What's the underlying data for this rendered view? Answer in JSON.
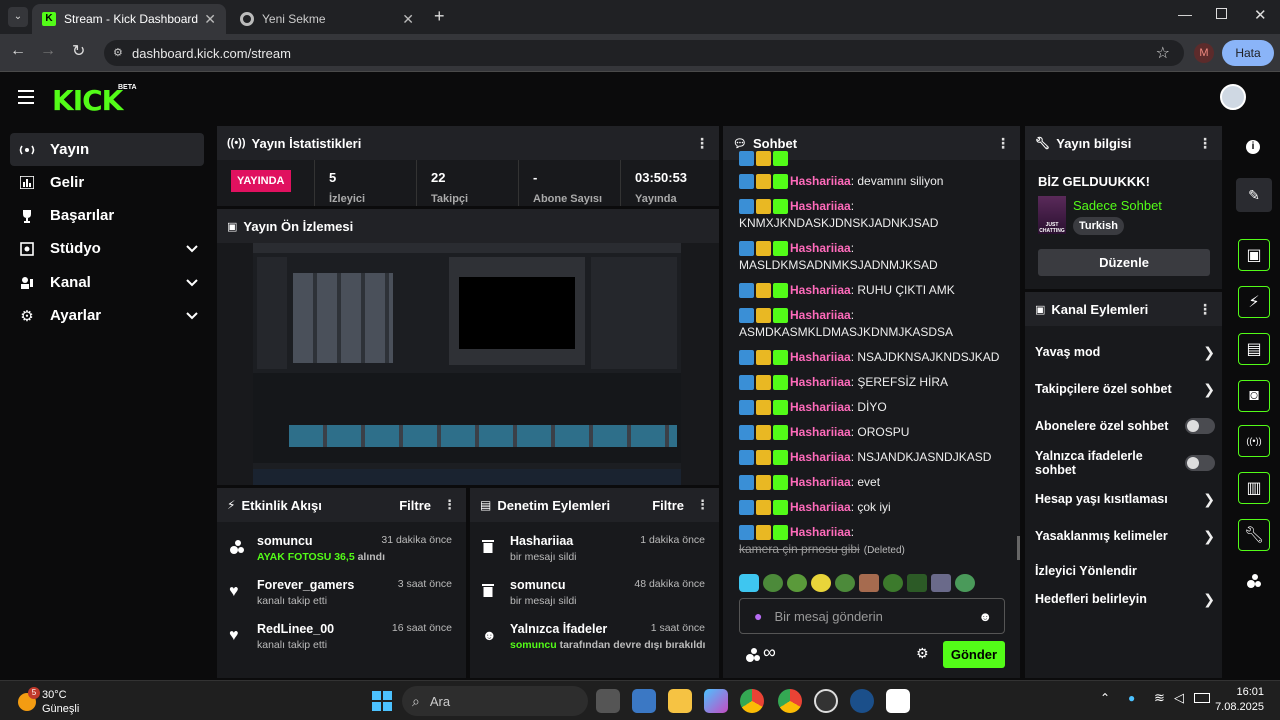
{
  "browser": {
    "tabs": [
      {
        "title": "Stream - Kick Dashboard"
      },
      {
        "title": "Yeni Sekme"
      }
    ],
    "url": "dashboard.kick.com/stream",
    "profile_initial": "M",
    "error_button": "Hata"
  },
  "header": {
    "logo": "KICK",
    "beta": "BETA"
  },
  "sidebar": {
    "items": [
      {
        "label": "Yayın",
        "icon": "broadcast-icon"
      },
      {
        "label": "Gelir",
        "icon": "chart-icon"
      },
      {
        "label": "Başarılar",
        "icon": "trophy-icon"
      },
      {
        "label": "Stüdyo",
        "icon": "studio-icon"
      },
      {
        "label": "Kanal",
        "icon": "channel-icon"
      },
      {
        "label": "Ayarlar",
        "icon": "gear-icon"
      }
    ]
  },
  "stats": {
    "title": "Yayın İstatistikleri",
    "live_badge": "YAYINDA",
    "cells": [
      {
        "value": "5",
        "label": "İzleyici"
      },
      {
        "value": "22",
        "label": "Takipçi"
      },
      {
        "value": "-",
        "label": "Abone Sayısı"
      },
      {
        "value": "03:50:53",
        "label": "Yayında"
      }
    ]
  },
  "preview": {
    "title": "Yayın Ön İzlemesi"
  },
  "activity": {
    "title": "Etkinlik Akışı",
    "filter": "Filtre",
    "items": [
      {
        "user": "somuncu",
        "time": "31 dakika önce",
        "highlight": "AYAK FOTOSU 36,5",
        "rest": " alındı"
      },
      {
        "user": "Forever_gamers",
        "time": "3 saat önce",
        "sub": "kanalı takip etti"
      },
      {
        "user": "RedLinee_00",
        "time": "16 saat önce",
        "sub": "kanalı takip etti"
      }
    ]
  },
  "moderation": {
    "title": "Denetim Eylemleri",
    "filter": "Filtre",
    "items": [
      {
        "user": "Hashariiaa",
        "time": "1 dakika önce",
        "sub": "bir mesajı sildi"
      },
      {
        "user": "somuncu",
        "time": "48 dakika önce",
        "sub": "bir mesajı sildi"
      },
      {
        "user": "Yalnızca İfadeler",
        "time": "1 saat önce",
        "sub_user": "somuncu",
        "sub": " tarafından devre dışı bırakıldı"
      }
    ]
  },
  "chat": {
    "title": "Sohbet",
    "messages": [
      {
        "user": "Hashariiaa",
        "text": "devamını siliyon"
      },
      {
        "user": "Hashariiaa",
        "text": "KNMXJKNDASKJDNSKJADNKJSAD"
      },
      {
        "user": "Hashariiaa",
        "text": "MASLDKMSADNMKSJADNMJKSAD"
      },
      {
        "user": "Hashariiaa",
        "text": "RUHU ÇIKTI AMK"
      },
      {
        "user": "Hashariiaa",
        "text": "ASMDKASMKLDMASJKDNMJKASDSA"
      },
      {
        "user": "Hashariiaa",
        "text": "NSAJDKNSAJKNDSJKAD"
      },
      {
        "user": "Hashariiaa",
        "text": "ŞEREFSİZ HİRA"
      },
      {
        "user": "Hashariiaa",
        "text": "DİYO"
      },
      {
        "user": "Hashariiaa",
        "text": "OROSPU"
      },
      {
        "user": "Hashariiaa",
        "text": "NSJANDKJASNDJKASD"
      },
      {
        "user": "Hashariiaa",
        "text": "evet"
      },
      {
        "user": "Hashariiaa",
        "text": "çok iyi"
      },
      {
        "user": "Hashariiaa",
        "text": "kamera çin prnosu gibi",
        "deleted": "(Deleted)"
      }
    ],
    "input_placeholder": "Bir mesaj gönderin",
    "send_button": "Gönder",
    "infinity": "∞"
  },
  "stream_info": {
    "title": "Yayın bilgisi",
    "stream_title": "BİZ GELDUUKKK!",
    "category": "Sadece Sohbet",
    "language": "Turkish",
    "edit_button": "Düzenle",
    "thumb_text": "JUST CHATTING"
  },
  "channel_actions": {
    "title": "Kanal Eylemleri",
    "items": [
      {
        "label": "Yavaş mod",
        "control": "arrow"
      },
      {
        "label": "Takipçilere özel sohbet",
        "control": "arrow"
      },
      {
        "label": "Abonelere özel sohbet",
        "control": "toggle"
      },
      {
        "label": "Yalnızca ifadelerle sohbet",
        "control": "toggle"
      },
      {
        "label": "Hesap yaşı kısıtlaması",
        "control": "arrow"
      },
      {
        "label": "Yasaklanmış kelimeler",
        "control": "arrow"
      },
      {
        "label": "İzleyici Yönlendir",
        "control": "none"
      },
      {
        "label": "Hedefleri belirleyin",
        "control": "arrow"
      }
    ]
  },
  "taskbar": {
    "weather_temp": "30°C",
    "weather_desc": "Güneşli",
    "weather_badge": "5",
    "search": "Ara",
    "time": "16:01",
    "date": "7.08.2025"
  },
  "colors": {
    "accent": "#53fc18",
    "live": "#e0115f",
    "username": "#ff6bbb"
  }
}
